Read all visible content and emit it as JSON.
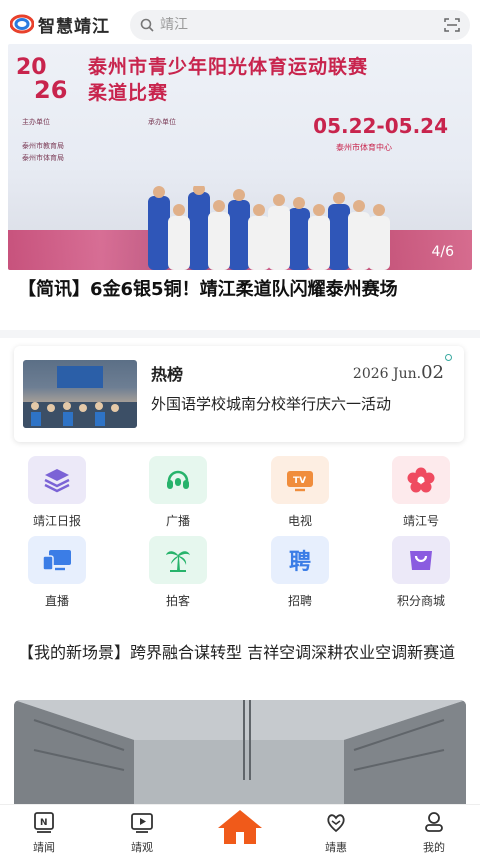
{
  "app": {
    "name": "智慧靖江"
  },
  "search": {
    "placeholder": "靖江"
  },
  "banner": {
    "year_top": "20",
    "year_bottom": "26",
    "title_line1": "泰州市青少年阳光体育运动联赛",
    "title_line2": "柔道比赛",
    "date_range": "05.22-05.24",
    "venue": "泰州市体育中心",
    "organizer_label": "主办单位",
    "organizers": [
      "泰州市教育局",
      "泰州市体育局"
    ],
    "host_label": "承办单位",
    "counter": "4/6"
  },
  "headline": "【简讯】6金6银5铜！靖江柔道队闪耀泰州赛场",
  "hot": {
    "tag": "热榜",
    "date_prefix": "2026 Jun.",
    "date_day": "02",
    "title": "外国语学校城南分校举行庆六一活动"
  },
  "grid": [
    {
      "label": "靖江日报",
      "icon": "layers-icon",
      "bg": "#ece9f8",
      "fg": "#7b63d6"
    },
    {
      "label": "广播",
      "icon": "headset-icon",
      "bg": "#e6f7ee",
      "fg": "#27b36b"
    },
    {
      "label": "电视",
      "icon": "tv-icon",
      "bg": "#fdeee2",
      "fg": "#f08d3c"
    },
    {
      "label": "靖江号",
      "icon": "flower-icon",
      "bg": "#fdeaec",
      "fg": "#ef4b60"
    },
    {
      "label": "直播",
      "icon": "devices-icon",
      "bg": "#e7effd",
      "fg": "#3b7de6"
    },
    {
      "label": "拍客",
      "icon": "palm-tree-icon",
      "bg": "#e6f7ee",
      "fg": "#27b36b"
    },
    {
      "label": "招聘",
      "icon": "hire-icon",
      "icon_text": "聘",
      "bg": "#e7effd",
      "fg": "#3b7de6"
    },
    {
      "label": "积分商城",
      "icon": "shopping-bag-icon",
      "bg": "#ece9f8",
      "fg": "#8a5ce0"
    }
  ],
  "article": {
    "title": "【我的新场景】跨界融合谋转型 吉祥空调深耕农业空调新赛道"
  },
  "tabs": [
    {
      "label": "靖闻",
      "icon": "news-icon"
    },
    {
      "label": "靖观",
      "icon": "video-icon"
    },
    {
      "label": "",
      "icon": "home-icon"
    },
    {
      "label": "靖惠",
      "icon": "benefit-icon"
    },
    {
      "label": "我的",
      "icon": "user-icon"
    }
  ],
  "colors": {
    "accent": "#c8244d",
    "home": "#f05a1a"
  }
}
